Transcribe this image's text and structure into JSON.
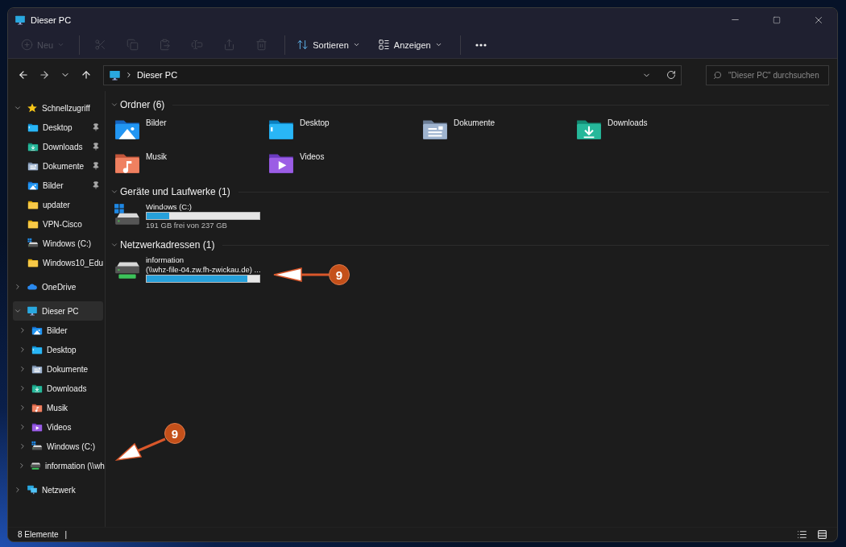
{
  "window": {
    "title": "Dieser PC"
  },
  "toolbar": {
    "items": [
      {
        "kind": "new",
        "label": "Neu",
        "disabled": true
      },
      {
        "kind": "cut",
        "disabled": true
      },
      {
        "kind": "copy",
        "disabled": true
      },
      {
        "kind": "paste",
        "disabled": true
      },
      {
        "kind": "rename",
        "disabled": true
      },
      {
        "kind": "share",
        "disabled": true
      },
      {
        "kind": "delete",
        "disabled": true
      },
      {
        "kind": "sort",
        "label": "Sortieren",
        "disabled": false
      },
      {
        "kind": "view",
        "label": "Anzeigen",
        "disabled": false
      },
      {
        "kind": "more",
        "disabled": false
      }
    ]
  },
  "address_bar": {
    "path": [
      "Dieser PC"
    ]
  },
  "search": {
    "placeholder": "\"Dieser PC\" durchsuchen"
  },
  "sidebar": {
    "groups": [
      {
        "label": "Schnellzugriff",
        "kind": "star",
        "expanded": true,
        "selected": false,
        "children": [
          {
            "label": "Desktop",
            "kind": "desktop",
            "pinned": true
          },
          {
            "label": "Downloads",
            "kind": "downloads",
            "pinned": true
          },
          {
            "label": "Dokumente",
            "kind": "documents",
            "pinned": true
          },
          {
            "label": "Bilder",
            "kind": "pictures",
            "pinned": true
          },
          {
            "label": "updater",
            "kind": "folder",
            "pinned": false
          },
          {
            "label": "VPN-Cisco",
            "kind": "folder",
            "pinned": false
          },
          {
            "label": "Windows (C:)",
            "kind": "drive",
            "pinned": false
          },
          {
            "label": "Windows10_Edu",
            "kind": "folder",
            "pinned": false
          }
        ]
      },
      {
        "label": "OneDrive",
        "kind": "cloud",
        "expanded": false,
        "selected": false
      },
      {
        "label": "Dieser PC",
        "kind": "pc",
        "expanded": true,
        "selected": true,
        "children": [
          {
            "label": "Bilder",
            "kind": "pictures",
            "expanded": false
          },
          {
            "label": "Desktop",
            "kind": "desktop",
            "expanded": false
          },
          {
            "label": "Dokumente",
            "kind": "documents",
            "expanded": false
          },
          {
            "label": "Downloads",
            "kind": "downloads",
            "expanded": false
          },
          {
            "label": "Musik",
            "kind": "music",
            "expanded": false
          },
          {
            "label": "Videos",
            "kind": "videos",
            "expanded": false
          },
          {
            "label": "Windows (C:)",
            "kind": "drive",
            "expanded": false
          },
          {
            "label": "information (\\\\wh",
            "kind": "network-drive",
            "expanded": false
          }
        ]
      },
      {
        "label": "Netzwerk",
        "kind": "network",
        "expanded": false,
        "selected": false
      }
    ]
  },
  "sections": [
    {
      "title": "Ordner (6)",
      "kind": "folders",
      "expanded": true,
      "items": [
        {
          "name": "Bilder",
          "kind": "pictures"
        },
        {
          "name": "Desktop",
          "kind": "desktop"
        },
        {
          "name": "Dokumente",
          "kind": "documents"
        },
        {
          "name": "Downloads",
          "kind": "downloads"
        },
        {
          "name": "Musik",
          "kind": "music"
        },
        {
          "name": "Videos",
          "kind": "videos"
        }
      ]
    },
    {
      "title": "Geräte und Laufwerke (1)",
      "kind": "drives",
      "expanded": true,
      "items": [
        {
          "name": "Windows (C:)",
          "kind": "drive",
          "level": 0.2,
          "detail": "191 GB frei von 237 GB"
        }
      ]
    },
    {
      "title": "Netzwerkadressen (1)",
      "kind": "drives",
      "expanded": true,
      "items": [
        {
          "name": "information",
          "subtitle": "(\\\\whz-file-04.zw.fh-zwickau.de) ...",
          "kind": "network-drive",
          "level": 0.89
        }
      ]
    }
  ],
  "status_bar": {
    "count": "8 Elemente",
    "divider": "|"
  },
  "annotations": [
    {
      "label": "9"
    },
    {
      "label": "9"
    }
  ]
}
